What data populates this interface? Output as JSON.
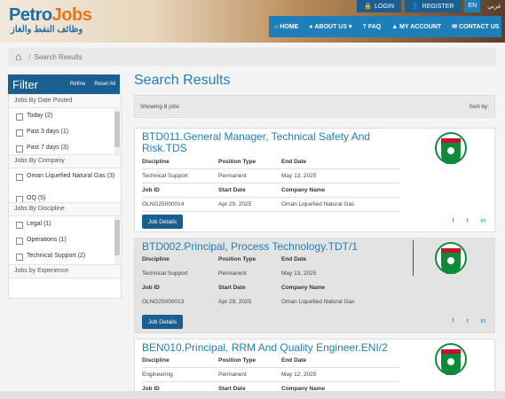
{
  "logo": {
    "brand_a": "Petro",
    "brand_b": "Jobs",
    "arabic": "وظائف النفط والغاز"
  },
  "topbar": {
    "login": "LOGIN",
    "register": "REGISTER",
    "lang_en": "EN",
    "lang_ar": "عربي"
  },
  "nav": {
    "home": "HOME",
    "about": "ABOUT US",
    "faq": "FAQ",
    "account": "MY ACCOUNT",
    "contact": "CONTACT US"
  },
  "breadcrumb": {
    "current": "Search Results"
  },
  "filter": {
    "title": "Filter",
    "refine": "Refine",
    "reset": "Reset All",
    "date_title": "Jobs By Date Posted",
    "date_opts": [
      "Today (2)",
      "Past 3 days (1)",
      "Past 7 days (3)"
    ],
    "company_title": "Jobs By Company",
    "company_opts": [
      "Oman Liquefied Natural Gas (3)",
      "OQ (5)"
    ],
    "discipline_title": "Jobs By Discipline",
    "discipline_opts": [
      "Legal (1)",
      "Operations (1)",
      "Technical Support (2)"
    ],
    "experience_title": "Jobs by Experience"
  },
  "results": {
    "title": "Search Results",
    "showing": "Showing 8 jobs",
    "sort": "Sort by:"
  },
  "labels": {
    "discipline": "Discipline",
    "position_type": "Position Type",
    "end_date": "End Date",
    "job_id": "Job ID",
    "start_date": "Start Date",
    "company_name": "Company Name",
    "details": "Job Details"
  },
  "jobs": [
    {
      "title": "BTD011.General Manager, Technical Safety And Risk.TDS",
      "discipline": "Technical Support",
      "position_type": "Permanent",
      "end_date": "May 13, 2025",
      "job_id": "OLNG25000014",
      "start_date": "Apr 29, 2025",
      "company": "Oman Liquefied Natural Gas"
    },
    {
      "title": "BTD002.Principal, Process Technology.TDT/1",
      "discipline": "Technical Support",
      "position_type": "Permanent",
      "end_date": "May 13, 2025",
      "job_id": "OLNG25000013",
      "start_date": "Apr 29, 2025",
      "company": "Oman Liquefied Natural Gas"
    },
    {
      "title": "BEN010.Principal, RRM And Quality Engineer.ENI/2",
      "discipline": "Engineering",
      "position_type": "Permanent",
      "end_date": "May 12, 2025"
    }
  ],
  "share": {
    "facebook": "f",
    "twitter": "t",
    "linkedin": "in"
  },
  "colors": {
    "brand": "#1e7fb8",
    "dark": "#1a5f8f",
    "logo_green": "#0f8a3a",
    "logo_red": "#c8102e"
  }
}
